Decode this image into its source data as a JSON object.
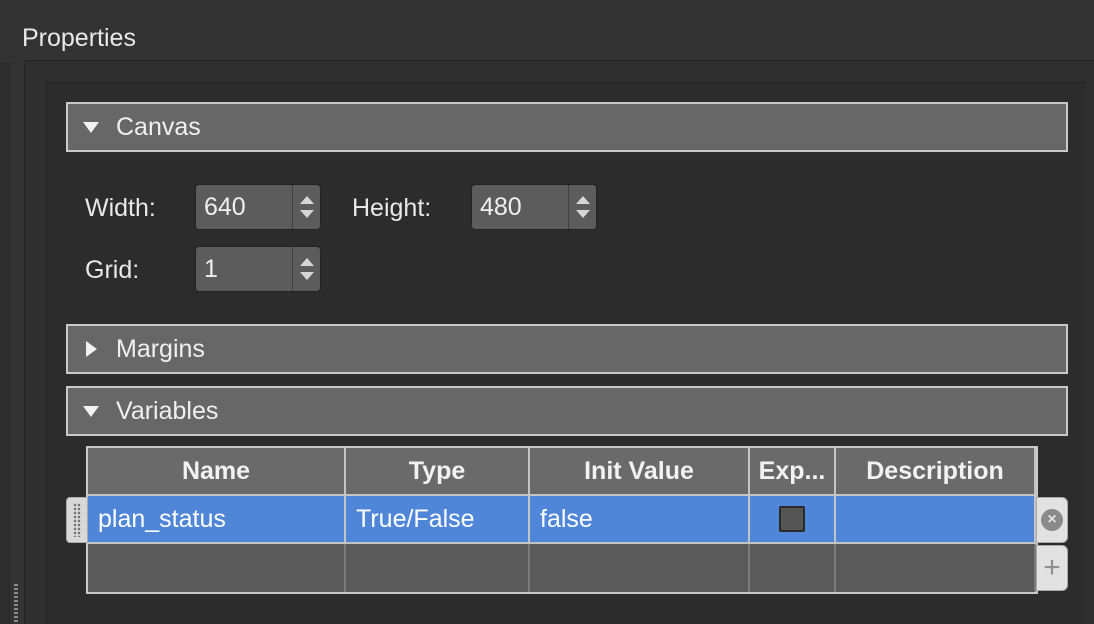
{
  "panel": {
    "title": "Properties"
  },
  "sections": {
    "canvas": {
      "label": "Canvas",
      "expanded": true
    },
    "margins": {
      "label": "Margins",
      "expanded": false
    },
    "variables": {
      "label": "Variables",
      "expanded": true
    }
  },
  "canvas": {
    "width_label": "Width:",
    "width_value": "640",
    "height_label": "Height:",
    "height_value": "480",
    "grid_label": "Grid:",
    "grid_value": "1"
  },
  "variables_table": {
    "columns": [
      "Name",
      "Type",
      "Init Value",
      "Exp...",
      "Description"
    ],
    "rows": [
      {
        "name": "plan_status",
        "type": "True/False",
        "init_value": "false",
        "exported": false,
        "description": "",
        "selected": true
      }
    ]
  },
  "icons": {
    "section_toggle_expanded": "triangle-down-icon",
    "section_toggle_collapsed": "triangle-right-icon",
    "remove_row": "remove-circle-icon",
    "add_row": "plus-icon",
    "row_drag": "drag-handle-icon"
  },
  "colors": {
    "background": "#333333",
    "section_header": "#676767",
    "selection": "#4f86d8",
    "text": "#e6e6e6"
  }
}
